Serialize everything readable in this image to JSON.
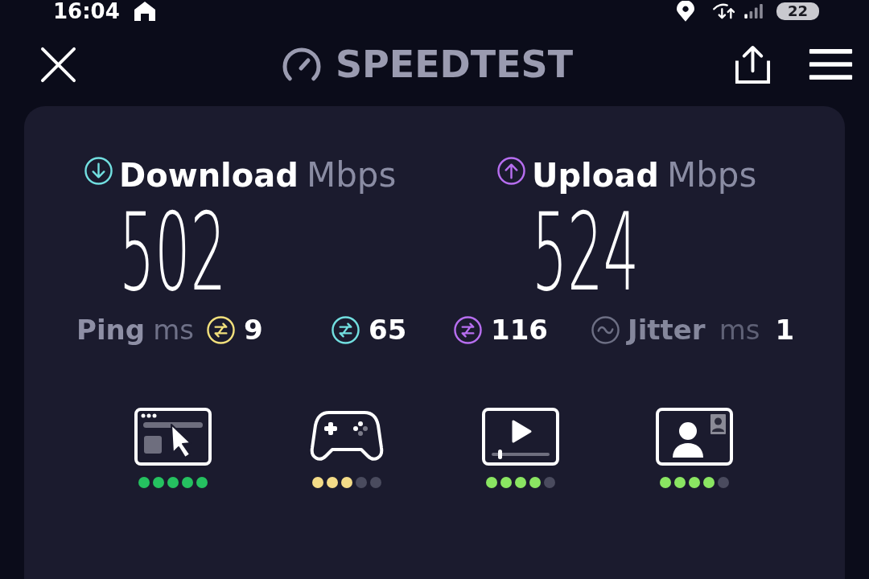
{
  "status_bar": {
    "time": "16:04",
    "battery": "22"
  },
  "header": {
    "title": "SPEEDTEST"
  },
  "results": [
    {
      "kind": "download",
      "label": "Download",
      "unit": "Mbps",
      "value": "502",
      "color": "#72dfe0"
    },
    {
      "kind": "upload",
      "label": "Upload",
      "unit": "Mbps",
      "value": "524",
      "color": "#b76ef0"
    }
  ],
  "latency": [
    {
      "kind": "ping",
      "label": "Ping",
      "unit": "ms",
      "value": "9",
      "color": "#f2e07c"
    },
    {
      "kind": "loaded",
      "value": "65",
      "color": "#72dfe0"
    },
    {
      "kind": "loaded",
      "value": "116",
      "color": "#b76ef0"
    },
    {
      "kind": "jitter",
      "label": "Jitter",
      "unit": "ms",
      "value": "1",
      "color": "#6d6f84"
    }
  ],
  "experience": [
    {
      "kind": "browsing",
      "stars": 5,
      "color": "#25c160"
    },
    {
      "kind": "gaming",
      "stars": 3,
      "color": "#f4dc88"
    },
    {
      "kind": "streaming",
      "stars": 4,
      "color": "#8ae562"
    },
    {
      "kind": "video_call",
      "stars": 4,
      "color": "#8ae562"
    }
  ]
}
